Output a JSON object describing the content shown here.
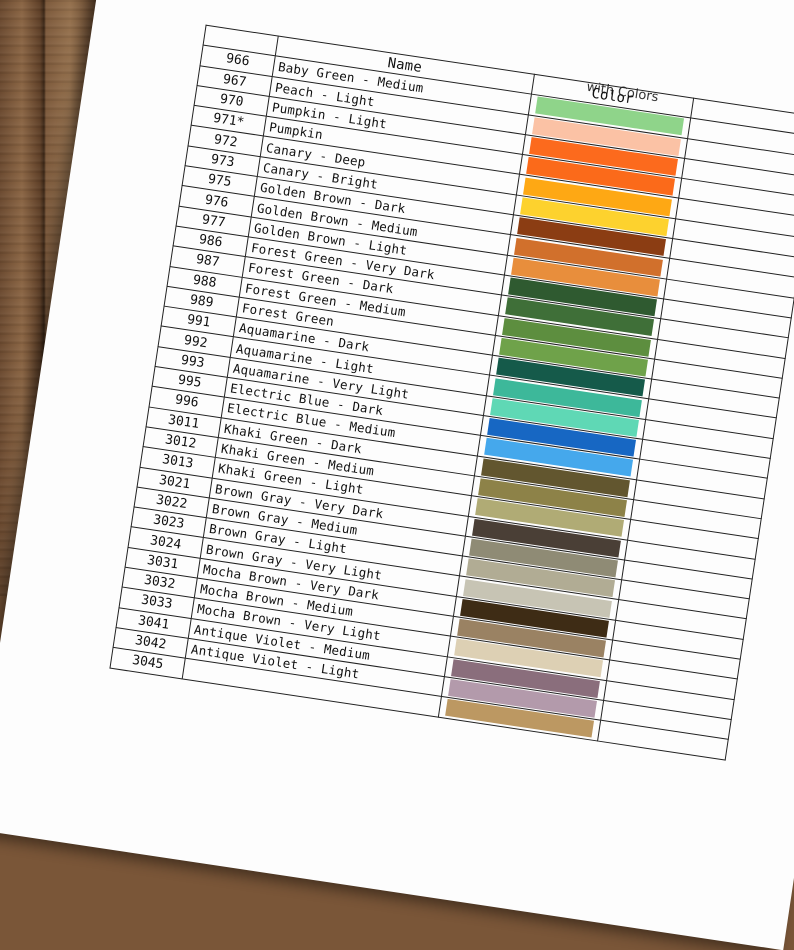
{
  "sheet": {
    "title_fragment": "with Colors",
    "header_name": "Name",
    "header_color": "Color"
  },
  "rows": [
    {
      "num": "966",
      "name": "Baby Green - Medium",
      "color": "#8fd48a"
    },
    {
      "num": "967",
      "name": "Peach - Light",
      "color": "#fbc2a5"
    },
    {
      "num": "970",
      "name": "Pumpkin - Light",
      "color": "#fc6a1d"
    },
    {
      "num": "971*",
      "name": "Pumpkin",
      "color": "#fb6a1a"
    },
    {
      "num": "972",
      "name": "Canary - Deep",
      "color": "#fea814"
    },
    {
      "num": "973",
      "name": "Canary - Bright",
      "color": "#fdd22e"
    },
    {
      "num": "975",
      "name": "Golden Brown - Dark",
      "color": "#8b3d13"
    },
    {
      "num": "976",
      "name": "Golden Brown - Medium",
      "color": "#d1702c"
    },
    {
      "num": "977",
      "name": "Golden Brown - Light",
      "color": "#e88e3c"
    },
    {
      "num": "986",
      "name": "Forest Green - Very Dark",
      "color": "#2f5a30"
    },
    {
      "num": "987",
      "name": "Forest Green - Dark",
      "color": "#3f6f38"
    },
    {
      "num": "988",
      "name": "Forest Green - Medium",
      "color": "#5d8e3f"
    },
    {
      "num": "989",
      "name": "Forest Green",
      "color": "#6fa24a"
    },
    {
      "num": "991",
      "name": "Aquamarine - Dark",
      "color": "#155a4a"
    },
    {
      "num": "992",
      "name": "Aquamarine - Light",
      "color": "#3db89a"
    },
    {
      "num": "993",
      "name": "Aquamarine - Very Light",
      "color": "#5fd8b5"
    },
    {
      "num": "995",
      "name": "Electric Blue - Dark",
      "color": "#1767c3"
    },
    {
      "num": "996",
      "name": "Electric Blue - Medium",
      "color": "#45a8ec"
    },
    {
      "num": "3011",
      "name": "Khaki Green - Dark",
      "color": "#62562f"
    },
    {
      "num": "3012",
      "name": "Khaki Green - Medium",
      "color": "#8d8248"
    },
    {
      "num": "3013",
      "name": "Khaki Green - Light",
      "color": "#b0ab75"
    },
    {
      "num": "3021",
      "name": "Brown Gray - Very Dark",
      "color": "#4a3f36"
    },
    {
      "num": "3022",
      "name": "Brown Gray - Medium",
      "color": "#8f8b75"
    },
    {
      "num": "3023",
      "name": "Brown Gray - Light",
      "color": "#b1ac94"
    },
    {
      "num": "3024",
      "name": "Brown Gray - Very Light",
      "color": "#c7c4b4"
    },
    {
      "num": "3031",
      "name": "Mocha Brown - Very Dark",
      "color": "#3e2c15"
    },
    {
      "num": "3032",
      "name": "Mocha Brown - Medium",
      "color": "#9a8263"
    },
    {
      "num": "3033",
      "name": "Mocha Brown - Very Light",
      "color": "#ddd0b4"
    },
    {
      "num": "3041",
      "name": "Antique Violet - Medium",
      "color": "#8a6e7c"
    },
    {
      "num": "3042",
      "name": "Antique Violet - Light",
      "color": "#b39aab"
    },
    {
      "num": "3045",
      "name": "",
      "color": "#bc9862"
    }
  ]
}
